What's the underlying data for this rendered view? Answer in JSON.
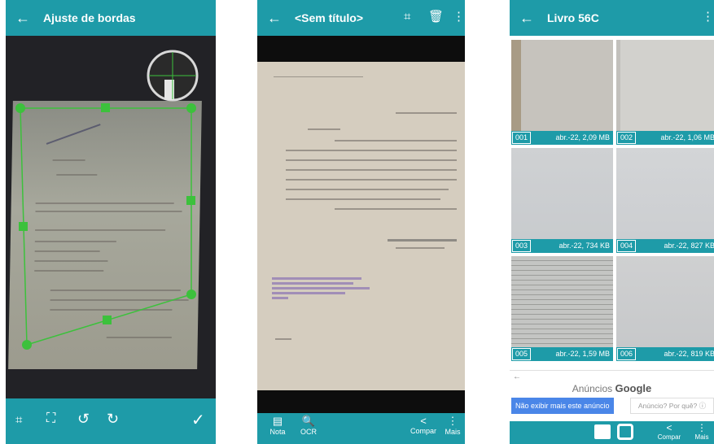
{
  "screen1": {
    "title": "Ajuste de bordas",
    "icons": [
      "back-arrow-icon",
      "crop-auto-icon",
      "fullscreen-icon",
      "rotate-left-icon",
      "rotate-right-icon",
      "check-icon"
    ],
    "colors": {
      "appbar": "#1e9ba8",
      "crop_handles": "#3cc13c"
    }
  },
  "screen2": {
    "title": "<Sem título>",
    "bottom_labels": {
      "note": "Nota",
      "ocr": "OCR",
      "share": "Compar",
      "more": "Mais"
    },
    "icons": [
      "back-arrow-icon",
      "crop-icon",
      "trash-icon",
      "more-vert-icon",
      "note-icon",
      "ocr-icon",
      "share-icon",
      "more-vert-icon"
    ]
  },
  "screen3": {
    "title": "Livro 56C",
    "pages": [
      {
        "num": "001",
        "info": "abr.-22, 2,09 MB"
      },
      {
        "num": "002",
        "info": "abr.-22, 1,06 MB"
      },
      {
        "num": "003",
        "info": "abr.-22, 734 KB"
      },
      {
        "num": "004",
        "info": "abr.-22, 827 KB"
      },
      {
        "num": "005",
        "info": "abr.-22, 1,59 MB"
      },
      {
        "num": "006",
        "info": "abr.-22, 819 KB"
      }
    ],
    "ad": {
      "label": "Anúncios",
      "brand": "Google",
      "stop_button": "Não exibir mais este anúncio",
      "why": "Anúncio? Por quê?"
    },
    "bottom_labels": {
      "share": "Compar",
      "more": "Mais"
    },
    "icons": [
      "back-arrow-icon",
      "more-vert-icon",
      "gallery-icon",
      "camera-icon",
      "share-icon",
      "more-vert-icon"
    ]
  }
}
